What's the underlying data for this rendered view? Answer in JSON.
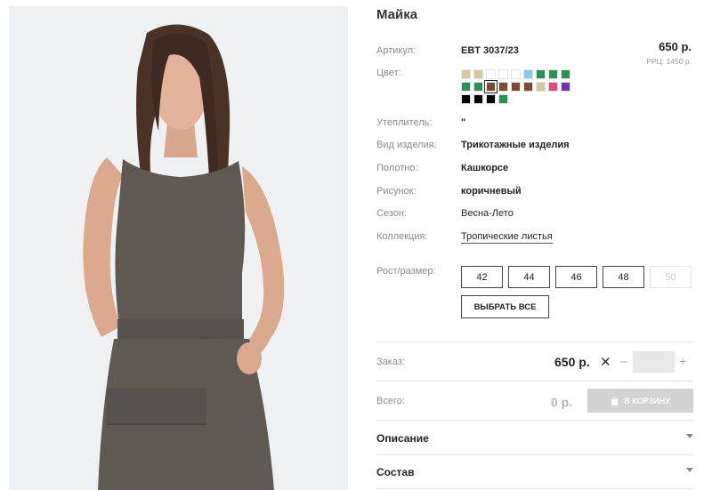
{
  "product": {
    "title": "Майка",
    "price": "650 р.",
    "rrc": "РРЦ: 1450 р."
  },
  "specs": {
    "article": {
      "label": "Артикул:",
      "value": "EBT 3037/23"
    },
    "color": {
      "label": "Цвет:"
    },
    "insulation": {
      "label": "Утеплитель:",
      "value": "\""
    },
    "type": {
      "label": "Вид изделия:",
      "value": "Трикотажные изделия"
    },
    "fabric": {
      "label": "Полотно:",
      "value": "Кашкорсе"
    },
    "pattern": {
      "label": "Рисунок:",
      "value": "коричневый"
    },
    "season": {
      "label": "Сезон:",
      "value": "Весна-Лето"
    },
    "collection": {
      "label": "Коллекция:",
      "value": "Тропические листья"
    }
  },
  "swatches": [
    [
      "#d6c6a4",
      "#d6c6a4",
      "#ffffff",
      "#ffffff",
      "#ffffff",
      "#8ac8ef",
      "#2c8f55",
      "#2c8f55",
      "#2c8f55"
    ],
    [
      "#2c8f55",
      "#2c8f55",
      "#7a4a33",
      "#7a4a33",
      "#7a4a33",
      "#7a4a33",
      "#d6c6a4",
      "#e8427a",
      "#7a2fb8"
    ],
    [
      "#000000",
      "#000000",
      "#000000",
      "#2c8f55"
    ]
  ],
  "selected_swatch": {
    "row": 1,
    "index": 2
  },
  "sizes": {
    "label": "Рост/размер:",
    "options": [
      {
        "value": "42",
        "available": true
      },
      {
        "value": "44",
        "available": true
      },
      {
        "value": "46",
        "available": true
      },
      {
        "value": "48",
        "available": true
      },
      {
        "value": "50",
        "available": false
      }
    ],
    "select_all": "ВЫБРАТЬ ВСЕ"
  },
  "order": {
    "label": "Заказ:",
    "price": "650 р.",
    "times": "✕",
    "minus": "–",
    "plus": "+",
    "qty": ""
  },
  "total": {
    "label": "Всего:",
    "value": "0 р.",
    "cart_button": "В КОРЗИНУ"
  },
  "accordion": {
    "description": "Описание",
    "composition": "Состав"
  },
  "colors": {
    "dress": "#5f5954",
    "background": "#eef0f2",
    "cart_disabled": "#d2d2d2"
  }
}
